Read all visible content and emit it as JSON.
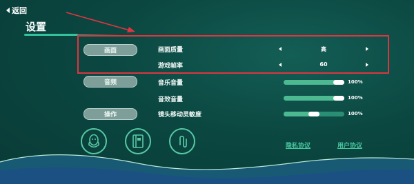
{
  "header": {
    "back_label": "返回",
    "title": "设置"
  },
  "categories": {
    "display": "画面",
    "audio": "音频",
    "control": "操作"
  },
  "display": {
    "quality": {
      "label": "画面质量",
      "value": "高"
    },
    "framerate": {
      "label": "游戏帧率",
      "value": "60"
    }
  },
  "audio": {
    "music": {
      "label": "音乐音量",
      "value_text": "100%",
      "level": 1.0
    },
    "effects": {
      "label": "音效音量",
      "value_text": "100%",
      "level": 1.0
    }
  },
  "control": {
    "camera": {
      "label": "镜头移动灵敏度",
      "value_text": "100%",
      "level": 0.5
    }
  },
  "footer": {
    "icons": [
      "qq-icon",
      "notebook-icon",
      "paperclip-icon"
    ],
    "privacy_link": "隐私协议",
    "user_link": "用户协议"
  },
  "colors": {
    "accent": "#36c29a",
    "annotation_red": "#e0353f"
  }
}
